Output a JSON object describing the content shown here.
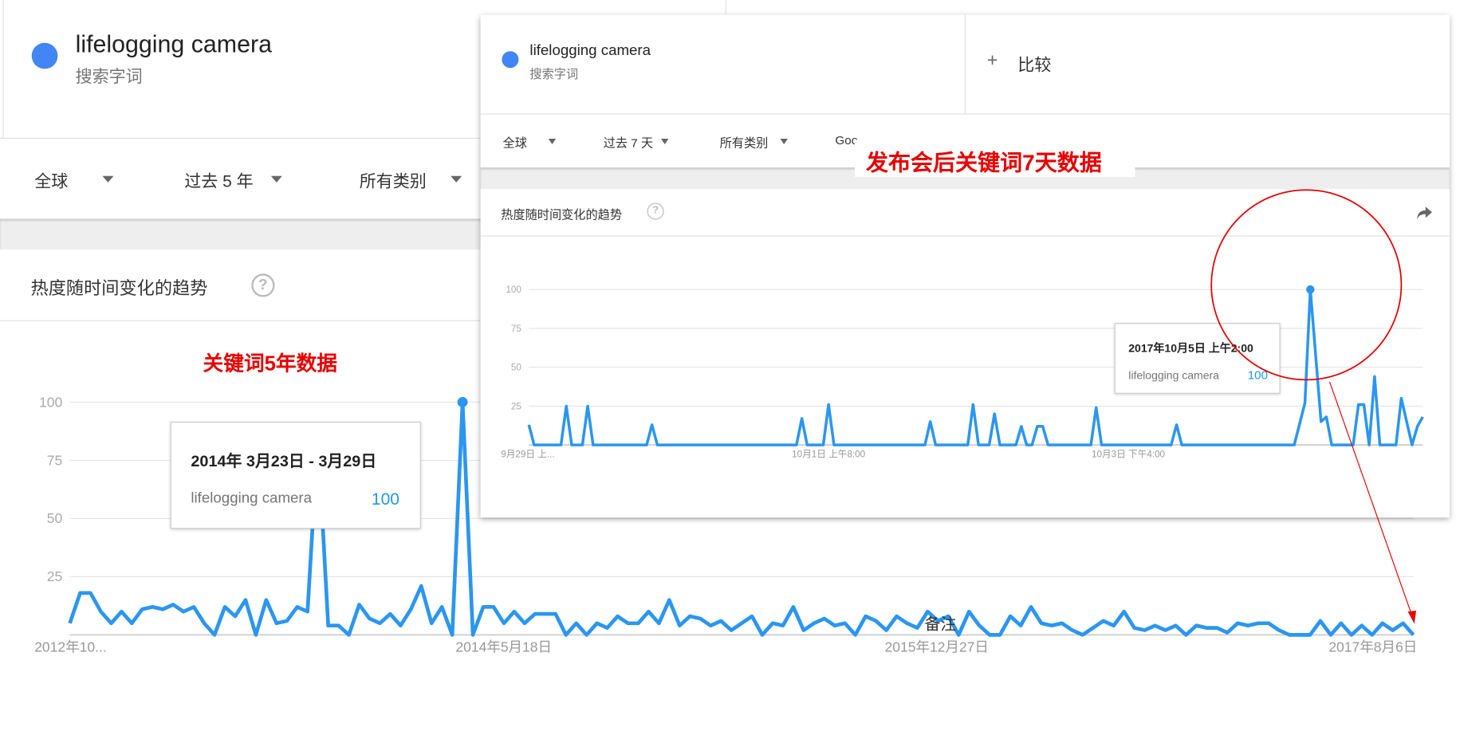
{
  "left_panel": {
    "term": {
      "label": "lifelogging camera",
      "sublabel": "搜索字词",
      "color": "#4285f4"
    },
    "filters": [
      {
        "label": "全球"
      },
      {
        "label": "过去 5 年"
      },
      {
        "label": "所有类别"
      }
    ],
    "card_title": "热度随时间变化的趋势",
    "help_icon": "?",
    "annotation": "关键词5年数据",
    "tooltip": {
      "date": "2014年 3月23日 - 3月29日",
      "term": "lifelogging camera",
      "value": "100"
    },
    "note_label": "备注"
  },
  "right_panel": {
    "term": {
      "label": "lifelogging camera",
      "sublabel": "搜索字词",
      "color": "#4285f4"
    },
    "compare": {
      "icon": "+",
      "label": "比较"
    },
    "filters": [
      {
        "label": "全球"
      },
      {
        "label": "过去 7 天"
      },
      {
        "label": "所有类别"
      },
      {
        "label": "Goo"
      }
    ],
    "card_title": "热度随时间变化的趋势",
    "help_icon": "?",
    "share_icon": "share-icon",
    "tooltip": {
      "date": "2017年10月5日 上午2:00",
      "term": "lifelogging camera",
      "value": "100"
    }
  },
  "callout": {
    "label": "发布会后关键词7天数据",
    "color": "#e60000"
  },
  "line_color": "#2b96ef",
  "chart_data": [
    {
      "type": "line",
      "title": "热度随时间变化的趋势",
      "ylim": [
        0,
        100
      ],
      "yticks": [
        "100",
        "75",
        "50",
        "25"
      ],
      "xticks": [
        "2012年10...",
        "2014年5月18日",
        "2015年12月27日",
        "2017年8月6日"
      ],
      "series": [
        {
          "name": "lifelogging camera",
          "values": [
            5,
            18,
            18,
            10,
            5,
            10,
            5,
            11,
            12,
            11,
            13,
            10,
            12,
            5,
            0,
            12,
            8,
            15,
            0,
            15,
            5,
            6,
            12,
            10,
            85,
            4,
            4,
            0,
            13,
            7,
            5,
            9,
            4,
            11,
            21,
            5,
            12,
            0,
            100,
            0,
            12,
            12,
            5,
            10,
            5,
            9,
            9,
            9,
            0,
            5,
            0,
            5,
            3,
            8,
            5,
            5,
            10,
            5,
            15,
            4,
            8,
            7,
            4,
            6,
            2,
            5,
            8,
            0,
            5,
            4,
            12,
            2,
            5,
            7,
            4,
            5,
            0,
            8,
            6,
            2,
            8,
            5,
            3,
            10,
            6,
            8,
            0,
            10,
            4,
            0,
            0,
            8,
            4,
            12,
            5,
            4,
            5,
            2,
            0,
            3,
            6,
            4,
            10,
            3,
            2,
            4,
            2,
            4,
            0,
            4,
            3,
            3,
            1,
            5,
            4,
            5,
            5,
            2,
            0,
            0,
            0,
            6,
            0,
            5,
            0,
            4,
            0,
            5,
            2,
            5,
            0
          ]
        }
      ]
    },
    {
      "type": "line",
      "title": "热度随时间变化的趋势",
      "ylim": [
        0,
        100
      ],
      "xlim_hours": [
        0,
        167
      ],
      "yticks": [
        "100",
        "75",
        "50",
        "25"
      ],
      "xticks": [
        {
          "label": "9月29日 上...",
          "hour": 0
        },
        {
          "label": "10月1日 上午8:00",
          "hour": 56
        },
        {
          "label": "10月3日 下午4:00",
          "hour": 112
        }
      ],
      "series": [
        {
          "name": "lifelogging camera",
          "points": [
            [
              0,
              13
            ],
            [
              1,
              0
            ],
            [
              6,
              0
            ],
            [
              7,
              25
            ],
            [
              8,
              0
            ],
            [
              10,
              0
            ],
            [
              11,
              25
            ],
            [
              12,
              0
            ],
            [
              22,
              0
            ],
            [
              23,
              13
            ],
            [
              24,
              0
            ],
            [
              50,
              0
            ],
            [
              51,
              17
            ],
            [
              52,
              0
            ],
            [
              55,
              0
            ],
            [
              56,
              26
            ],
            [
              57,
              0
            ],
            [
              74,
              0
            ],
            [
              75,
              15
            ],
            [
              76,
              0
            ],
            [
              82,
              0
            ],
            [
              83,
              26
            ],
            [
              84,
              0
            ],
            [
              86,
              0
            ],
            [
              87,
              20
            ],
            [
              88,
              0
            ],
            [
              91,
              0
            ],
            [
              92,
              12
            ],
            [
              93,
              0
            ],
            [
              94,
              0
            ],
            [
              95,
              12
            ],
            [
              96,
              12
            ],
            [
              97,
              0
            ],
            [
              105,
              0
            ],
            [
              106,
              24
            ],
            [
              107,
              0
            ],
            [
              120,
              0
            ],
            [
              121,
              13
            ],
            [
              122,
              0
            ],
            [
              143,
              0
            ],
            [
              145,
              27
            ],
            [
              146,
              100
            ],
            [
              148,
              15
            ],
            [
              149,
              18
            ],
            [
              150,
              0
            ],
            [
              154,
              0
            ],
            [
              155,
              26
            ],
            [
              156,
              26
            ],
            [
              157,
              0
            ],
            [
              158,
              44
            ],
            [
              159,
              0
            ],
            [
              162,
              0
            ],
            [
              163,
              30
            ],
            [
              165,
              0
            ],
            [
              166,
              12
            ],
            [
              167,
              18
            ]
          ]
        }
      ]
    }
  ]
}
